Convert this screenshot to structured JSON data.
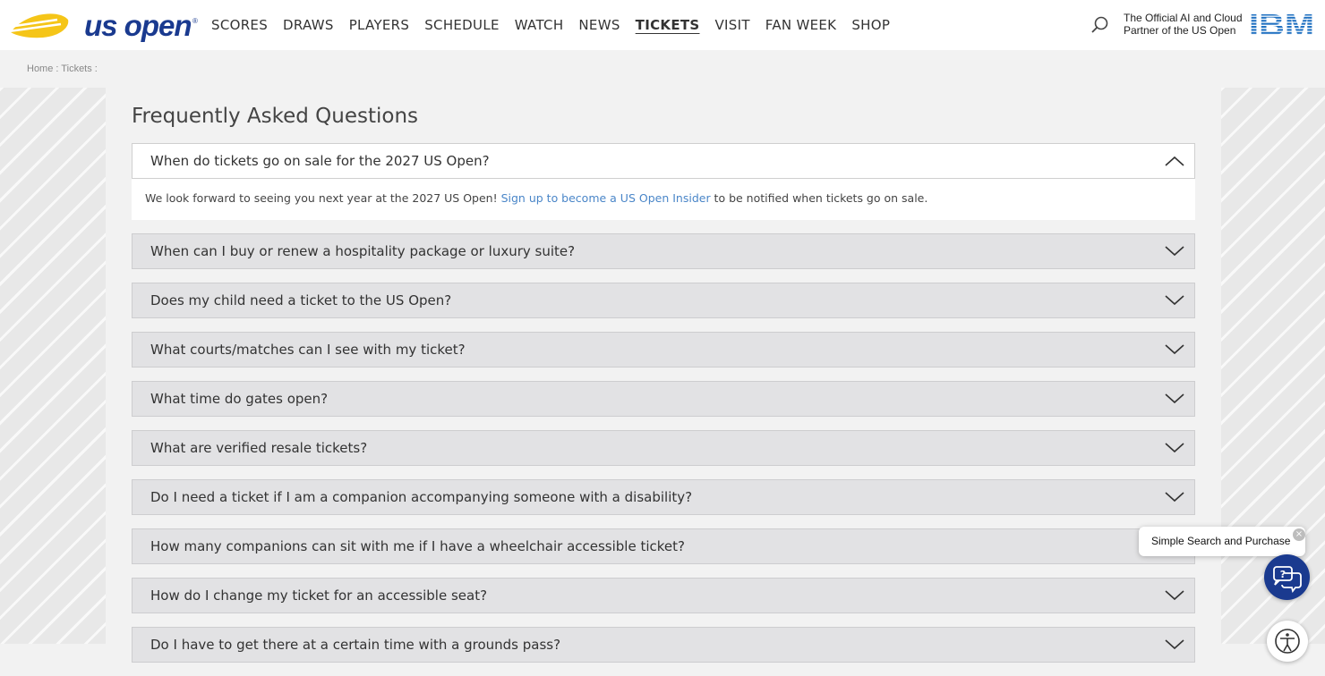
{
  "brand": {
    "logo_text": "us open",
    "registered_mark": "®",
    "color": "#1a3a8f",
    "accent": "#f5c518"
  },
  "nav": {
    "items": [
      "SCORES",
      "DRAWS",
      "PLAYERS",
      "SCHEDULE",
      "WATCH",
      "NEWS",
      "TICKETS",
      "VISIT",
      "FAN WEEK",
      "SHOP"
    ],
    "active": "TICKETS"
  },
  "partner": {
    "line1": "The Official AI and Cloud",
    "line2": "Partner of the US Open",
    "logo": "IBM"
  },
  "breadcrumb": "Home : Tickets :",
  "faq": {
    "title": "Frequently Asked Questions",
    "open_item": {
      "question": "When do tickets go on sale for the 2027 US Open?",
      "answer_before": "We look forward to seeing you next year at the 2027 US Open! ",
      "answer_link": "Sign up to become a US Open Insider",
      "answer_after": " to be notified when tickets go on sale."
    },
    "items": [
      "When can I buy or renew a hospitality package or luxury suite?",
      "Does my child need a ticket to the US Open?",
      "What courts/matches can I see with my ticket?",
      "What time do gates open?",
      "What are verified resale tickets?",
      "Do I need a ticket if I am a companion accompanying someone with a disability?",
      "How many companions can sit with me if I have a wheelchair accessible ticket?",
      "How do I change my ticket for an accessible seat?",
      "Do I have to get there at a certain time with a grounds pass?"
    ]
  },
  "chat": {
    "tooltip": "Simple Search and Purchase",
    "close": "×"
  },
  "colors": {
    "link": "#4a86c8",
    "item_bg": "#e2e2e4",
    "page_bg": "#f2f2f2"
  }
}
